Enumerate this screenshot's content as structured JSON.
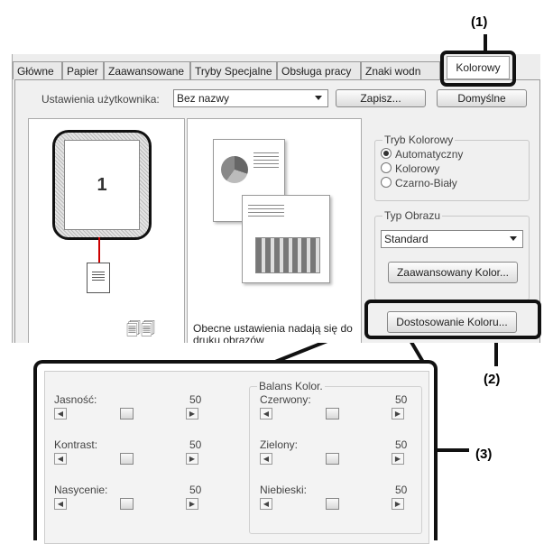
{
  "callouts": {
    "c1": "(1)",
    "c2": "(2)",
    "c3": "(3)"
  },
  "tabs": [
    "Główne",
    "Papier",
    "Zaawansowane",
    "Tryby Specjalne",
    "Obsługa pracy",
    "Znaki wodn",
    "Kolorowy"
  ],
  "user_settings": {
    "label": "Ustawienia użytkownika:",
    "value": "Bez nazwy",
    "save_button": "Zapisz...",
    "default_button": "Domyślne"
  },
  "preview": {
    "page_number": "1",
    "message": "Obecne ustawienia nadają się do druku obrazów"
  },
  "color_mode": {
    "title": "Tryb Kolorowy",
    "options": [
      "Automatyczny",
      "Kolorowy",
      "Czarno-Biały"
    ],
    "selected": 0
  },
  "image_type": {
    "title": "Typ Obrazu",
    "value": "Standard",
    "advanced_button": "Zaawansowany Kolor...",
    "adjust_button": "Dostosowanie Koloru..."
  },
  "adjust": {
    "left": [
      {
        "label": "Jasność:",
        "value": "50",
        "level": 0.5
      },
      {
        "label": "Kontrast:",
        "value": "50",
        "level": 0.5
      },
      {
        "label": "Nasycenie:",
        "value": "50",
        "level": 0.5
      }
    ],
    "balance_title": "Balans Kolor.",
    "right": [
      {
        "label": "Czerwony:",
        "value": "50",
        "level": 0.5
      },
      {
        "label": "Zielony:",
        "value": "50",
        "level": 0.5
      },
      {
        "label": "Niebieski:",
        "value": "50",
        "level": 0.5
      }
    ]
  }
}
